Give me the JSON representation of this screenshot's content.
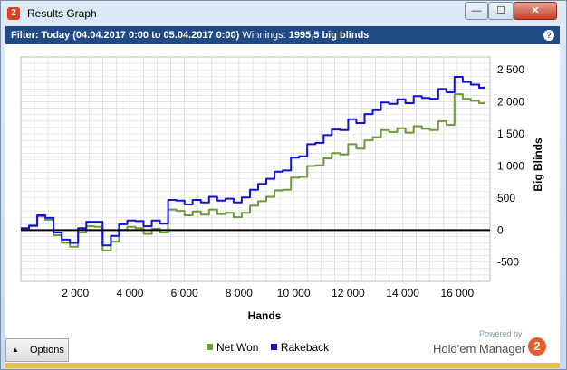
{
  "window": {
    "title": "Results Graph",
    "app_icon_glyph": "2",
    "minimize_glyph": "—",
    "maximize_glyph": "☐",
    "close_glyph": "✕"
  },
  "filter": {
    "label": "Filter:",
    "value": "Today (04.04.2017 0:00 to 05.04.2017 0:00)",
    "winnings_label": "Winnings:",
    "winnings_value": "1995,5 big blinds",
    "help_glyph": "?"
  },
  "bottom": {
    "options_label": "Options",
    "options_arrow": "▲",
    "powered_by": "Powered by",
    "brand": "Hold'em Manager",
    "brand_logo": "2"
  },
  "colors": {
    "net_won": "#6e9a3a",
    "rakeback": "#1010d8",
    "zero_line": "#000000",
    "grid": "#d4d4d4",
    "accent": "#1f4a86"
  },
  "chart_data": {
    "type": "line",
    "xlabel": "Hands",
    "ylabel": "Big Blinds",
    "xlim": [
      0,
      17200
    ],
    "ylim": [
      -800,
      2700
    ],
    "x_ticks": [
      2000,
      4000,
      6000,
      8000,
      10000,
      12000,
      14000,
      16000
    ],
    "x_tick_labels": [
      "2 000",
      "4 000",
      "6 000",
      "8 000",
      "10 000",
      "12 000",
      "14 000",
      "16 000"
    ],
    "y_ticks": [
      -500,
      0,
      500,
      1000,
      1500,
      2000,
      2500
    ],
    "y_tick_labels": [
      "-500",
      "0",
      "500",
      "1 000",
      "1 500",
      "2 000",
      "2 500"
    ],
    "grid": true,
    "legend_position": "bottom",
    "series": [
      {
        "name": "Net Won",
        "x": [
          0,
          300,
          600,
          900,
          1200,
          1500,
          1800,
          2100,
          2400,
          2700,
          3000,
          3300,
          3600,
          3900,
          4200,
          4500,
          4800,
          5100,
          5400,
          5700,
          6000,
          6300,
          6600,
          6900,
          7200,
          7500,
          7800,
          8100,
          8400,
          8700,
          9000,
          9300,
          9600,
          9900,
          10200,
          10500,
          10800,
          11100,
          11400,
          11700,
          12000,
          12300,
          12600,
          12900,
          13200,
          13500,
          13800,
          14100,
          14400,
          14700,
          15000,
          15300,
          15600,
          15900,
          16200,
          16500,
          16800,
          17000
        ],
        "y": [
          20,
          60,
          210,
          160,
          -80,
          -200,
          -260,
          -40,
          60,
          50,
          -320,
          -180,
          0,
          50,
          30,
          -60,
          20,
          -40,
          320,
          300,
          230,
          290,
          240,
          320,
          250,
          270,
          200,
          270,
          380,
          450,
          520,
          620,
          630,
          820,
          830,
          1000,
          1010,
          1120,
          1200,
          1180,
          1340,
          1270,
          1400,
          1450,
          1560,
          1530,
          1590,
          1520,
          1620,
          1580,
          1560,
          1700,
          1640,
          2120,
          2050,
          2020,
          1980,
          2000
        ]
      },
      {
        "name": "Rakeback",
        "x": [
          0,
          300,
          600,
          900,
          1200,
          1500,
          1800,
          2100,
          2400,
          2700,
          3000,
          3300,
          3600,
          3900,
          4200,
          4500,
          4800,
          5100,
          5400,
          5700,
          6000,
          6300,
          6600,
          6900,
          7200,
          7500,
          7800,
          8100,
          8400,
          8700,
          9000,
          9300,
          9600,
          9900,
          10200,
          10500,
          10800,
          11100,
          11400,
          11700,
          12000,
          12300,
          12600,
          12900,
          13200,
          13500,
          13800,
          14100,
          14400,
          14700,
          15000,
          15300,
          15600,
          15900,
          16200,
          16500,
          16800,
          17000
        ],
        "y": [
          30,
          70,
          230,
          190,
          -40,
          -150,
          -200,
          30,
          130,
          130,
          -240,
          -90,
          90,
          150,
          140,
          60,
          150,
          100,
          470,
          460,
          400,
          470,
          430,
          520,
          460,
          490,
          430,
          510,
          630,
          720,
          800,
          910,
          930,
          1130,
          1150,
          1340,
          1360,
          1480,
          1570,
          1560,
          1730,
          1670,
          1810,
          1870,
          1990,
          1970,
          2040,
          1980,
          2090,
          2060,
          2050,
          2200,
          2150,
          2390,
          2310,
          2270,
          2220,
          2240
        ]
      }
    ]
  }
}
